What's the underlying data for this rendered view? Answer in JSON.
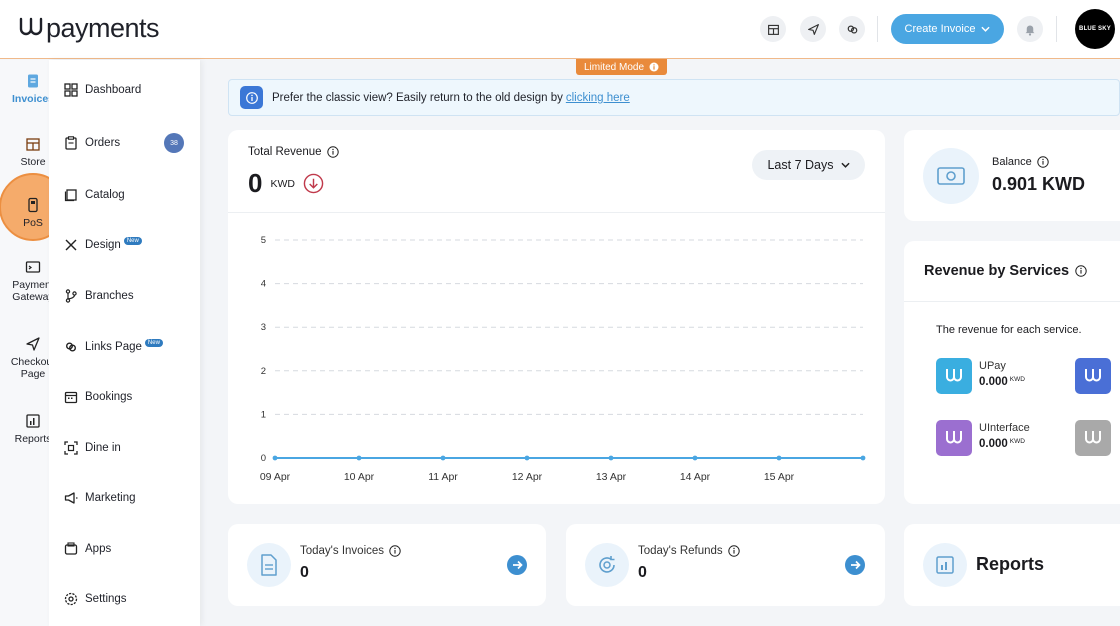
{
  "brand": {
    "name": "payments"
  },
  "topbar": {
    "create_invoice_label": "Create Invoice",
    "avatar_label": "BLUE SKY"
  },
  "limited_mode": {
    "label": "Limited Mode"
  },
  "rail": {
    "items": [
      {
        "label": "Invoices",
        "icon": "invoice-icon"
      },
      {
        "label": "Store",
        "icon": "store-icon"
      },
      {
        "label": "PoS",
        "icon": "pos-icon"
      },
      {
        "label_line1": "Payment",
        "label_line2": "Gateway",
        "icon": "gateway-icon"
      },
      {
        "label_line1": "Checkout",
        "label_line2": "Page",
        "icon": "checkout-icon"
      },
      {
        "label": "Reports",
        "icon": "reports-icon"
      }
    ]
  },
  "menu": {
    "items": [
      {
        "label": "Dashboard",
        "icon": "dashboard-icon"
      },
      {
        "label": "Orders",
        "icon": "orders-icon",
        "count": "38"
      },
      {
        "label": "Catalog",
        "icon": "catalog-icon"
      },
      {
        "label": "Design",
        "icon": "design-icon",
        "badge": "New"
      },
      {
        "label": "Branches",
        "icon": "branches-icon"
      },
      {
        "label": "Links Page",
        "icon": "links-icon",
        "badge": "New"
      },
      {
        "label": "Bookings",
        "icon": "bookings-icon"
      },
      {
        "label": "Dine in",
        "icon": "dine-in-icon"
      },
      {
        "label": "Marketing",
        "icon": "marketing-icon"
      },
      {
        "label": "Apps",
        "icon": "apps-icon"
      },
      {
        "label": "Settings",
        "icon": "settings-icon"
      }
    ]
  },
  "banner": {
    "text": "Prefer the classic view? Easily return to the old design by",
    "link": "clicking here"
  },
  "revenue": {
    "title": "Total Revenue",
    "value": "0",
    "currency": "KWD",
    "period": "Last 7 Days"
  },
  "balance": {
    "label": "Balance",
    "value": "0.901 KWD"
  },
  "services": {
    "title": "Revenue by Services",
    "description": "The revenue for each service.",
    "items": [
      {
        "name": "UPay",
        "amount": "0.000",
        "currency": "KWD",
        "color": "#3aaee0"
      },
      {
        "name": "UInterface",
        "amount": "0.000",
        "currency": "KWD",
        "color": "#9b6fd0"
      }
    ],
    "partial_tiles": [
      {
        "color": "#4a6fd6"
      },
      {
        "color": "#a9a9a9"
      }
    ]
  },
  "today_invoices": {
    "label": "Today's Invoices",
    "value": "0"
  },
  "today_refunds": {
    "label": "Today's Refunds",
    "value": "0"
  },
  "reports": {
    "title": "Reports"
  },
  "chart_data": {
    "type": "line",
    "x": [
      "09 Apr",
      "10 Apr",
      "11 Apr",
      "12 Apr",
      "13 Apr",
      "14 Apr",
      "15 Apr",
      ""
    ],
    "tick_labels_x": [
      "09 Apr",
      "10 Apr",
      "11 Apr",
      "12 Apr",
      "13 Apr",
      "14 Apr",
      "15 Apr"
    ],
    "series": [
      {
        "values": [
          0,
          0,
          0,
          0,
          0,
          0,
          0,
          0
        ],
        "color": "#4aa6e2"
      }
    ],
    "yticks": [
      0,
      1,
      2,
      3,
      4,
      5
    ],
    "ylim": [
      0,
      5
    ],
    "grid": true,
    "title": "",
    "xlabel": "",
    "ylabel": ""
  }
}
